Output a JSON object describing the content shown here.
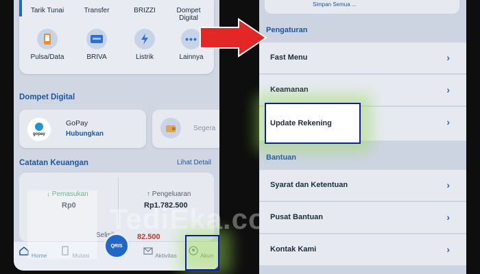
{
  "left": {
    "top_shortcuts": [
      "Tarik Tunai",
      "Transfer",
      "BRIZZI",
      "Dompet\nDigital"
    ],
    "services": [
      {
        "label": "Pulsa/Data",
        "icon": "phone-icon"
      },
      {
        "label": "BRIVA",
        "icon": "card-icon"
      },
      {
        "label": "Listrik",
        "icon": "lightning-icon"
      },
      {
        "label": "Lainnya",
        "icon": "more-dots-icon"
      }
    ],
    "dompet_title": "Dompet Digital",
    "gopay": {
      "name": "GoPay",
      "action": "Hubungkan",
      "logo_text": "gopay"
    },
    "segera_label": "Segera",
    "catatan_title": "Catatan Keuangan",
    "lihat_detail": "Lihat Detail",
    "pemasukan_label": "↓ Pemasukan",
    "pemasukan_value": "Rp0",
    "pengeluaran_label": "↑ Pengeluaran",
    "pengeluaran_value": "Rp1.782.500",
    "selisih_label": "Selisih",
    "selisih_value": "82.500",
    "nav": [
      "Home",
      "Mutasi",
      "Aktivitas",
      "Akun"
    ],
    "qris_label": "QRIS"
  },
  "right": {
    "profile_hint": "Simpan Semua ...",
    "pengaturan_title": "Pengaturan",
    "pengaturan_items": [
      "Fast Menu",
      "Keamanan",
      "Update Rekening"
    ],
    "bantuan_title": "Bantuan",
    "bantuan_items": [
      "Syarat dan Ketentuan",
      "Pusat Bantuan",
      "Kontak Kami"
    ]
  },
  "watermark": "TediEka.com",
  "colors": {
    "accent": "#1f67c9",
    "highlight": "#0a1ab3",
    "arrow": "#e32626",
    "glow": "#96dc50"
  }
}
